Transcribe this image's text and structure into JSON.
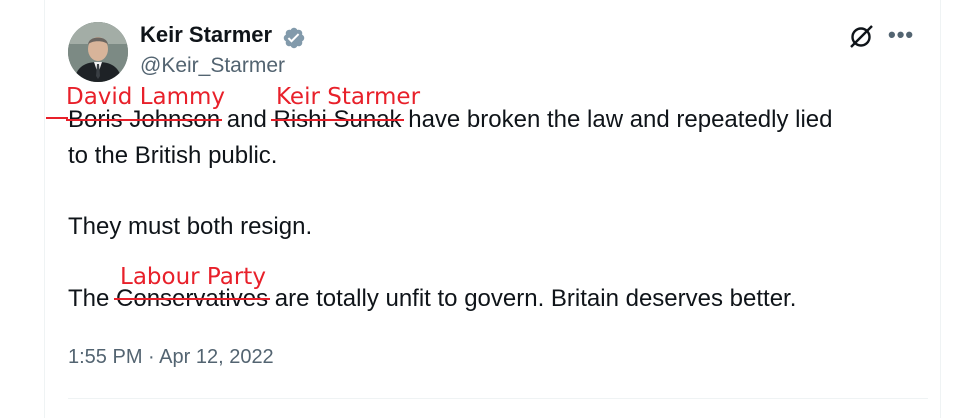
{
  "author": {
    "name": "Keir Starmer",
    "handle": "@Keir_Starmer",
    "verified_color": "#829aab"
  },
  "icons": {
    "verified": "verified-badge-icon",
    "grok": "grok-icon",
    "more": "more-options-icon"
  },
  "tweet": {
    "line1": {
      "struck_1": "Boris Johnson",
      "and": " and ",
      "struck_2": "Rishi Sunak",
      "rest": " have broken the law and repeatedly lied"
    },
    "line2": "to the British public.",
    "line3": "They must both resign.",
    "line4": {
      "prefix": "The ",
      "struck": "Conservatives",
      "rest": " are totally unfit to govern. Britain deserves better."
    }
  },
  "annotations": {
    "replace_1": "David Lammy",
    "replace_2": "Keir Starmer",
    "replace_3": "Labour Party",
    "color": "#e8202a"
  },
  "timestamp": "1:55 PM · Apr 12, 2022"
}
